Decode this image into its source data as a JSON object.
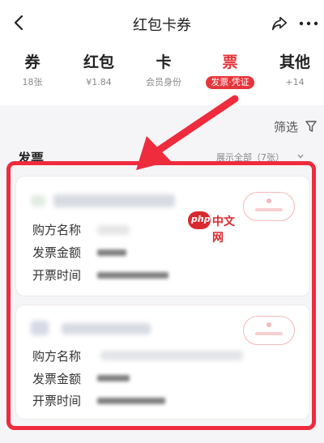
{
  "header": {
    "title": "红包卡券",
    "back_icon": "chevron-left-icon",
    "share_icon": "share-icon",
    "more_icon": "more-icon"
  },
  "tabs": [
    {
      "label": "券",
      "sub": "18张"
    },
    {
      "label": "红包",
      "sub": "¥1.84"
    },
    {
      "label": "卡",
      "sub": "会员身份"
    },
    {
      "label": "票",
      "sub": "发票·凭证",
      "active": true
    },
    {
      "label": "其他",
      "sub": "+14"
    }
  ],
  "filter": {
    "label": "筛选",
    "icon": "filter-icon"
  },
  "section": {
    "title": "发票",
    "show_all": "展示全部（7张）"
  },
  "invoices": [
    {
      "buyer_label": "购方名称",
      "amount_label": "发票金额",
      "time_label": "开票时间"
    },
    {
      "buyer_label": "购方名称",
      "amount_label": "发票金额",
      "time_label": "开票时间"
    }
  ],
  "watermark": {
    "badge": "php",
    "text": "中文网"
  },
  "colors": {
    "accent": "#e6353a",
    "highlight": "#ee2c3d"
  }
}
